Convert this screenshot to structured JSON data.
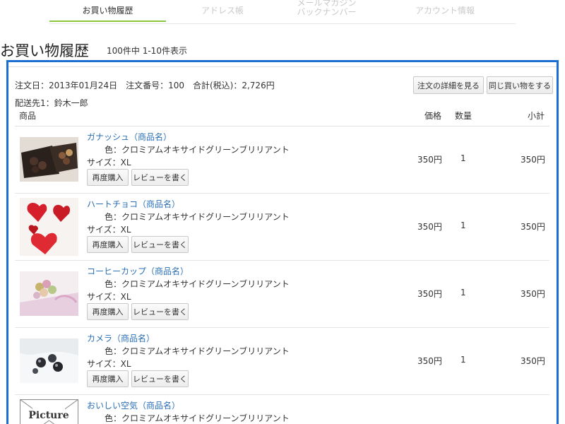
{
  "tabs": [
    {
      "label": "お買い物履歴",
      "active": true
    },
    {
      "label": "アドレス帳",
      "active": false
    },
    {
      "label": "メールマガジン\nバックナンバー",
      "active": false
    },
    {
      "label": "アカウント情報",
      "active": false
    }
  ],
  "page": {
    "title": "お買い物履歴",
    "count": "100件中 1-10件表示"
  },
  "order": {
    "info": "注文日：2013年01月24日　注文番号：100　合計(税込)：2,726円",
    "ship_to": "配送先1：鈴木一郎",
    "detail_button": "注文の詳細を見る",
    "same_button": "同じ買い物をする"
  },
  "columns": {
    "product": "商品",
    "price": "価格",
    "qty": "数量",
    "subtotal": "小計"
  },
  "item_buttons": {
    "rebuy": "再度購入",
    "review": "レビューを書く"
  },
  "items": [
    {
      "name": "ガナッシュ（商品名）",
      "color": "色：クロミアムオキサイドグリーンブリリアント",
      "size": "サイズ：XL",
      "price": "350円",
      "qty": "1",
      "subtotal": "350円",
      "image": "chocolates-tray"
    },
    {
      "name": "ハートチョコ（商品名）",
      "color": "色：クロミアムオキサイドグリーンブリリアント",
      "size": "サイズ：XL",
      "price": "350円",
      "qty": "1",
      "subtotal": "350円",
      "image": "heart-chocolates"
    },
    {
      "name": "コーヒーカップ（商品名）",
      "color": "色：クロミアムオキサイドグリーンブリリアント",
      "size": "サイズ：XL",
      "price": "350円",
      "qty": "1",
      "subtotal": "350円",
      "image": "macarons"
    },
    {
      "name": "カメラ（商品名）",
      "color": "色：クロミアムオキサイドグリーンブリリアント",
      "size": "サイズ：XL",
      "price": "350円",
      "qty": "1",
      "subtotal": "350円",
      "image": "chocolate-balls"
    },
    {
      "name": "おいしい空気（商品名）",
      "color": "色：クロミアムオキサイドグリーンブリリアント",
      "image": "picture-not-available",
      "image_text": "Picture"
    }
  ],
  "colors": {
    "highlight": "#1a6fd0",
    "active_tab": "#8cc63f",
    "link": "#2a6fb5"
  }
}
